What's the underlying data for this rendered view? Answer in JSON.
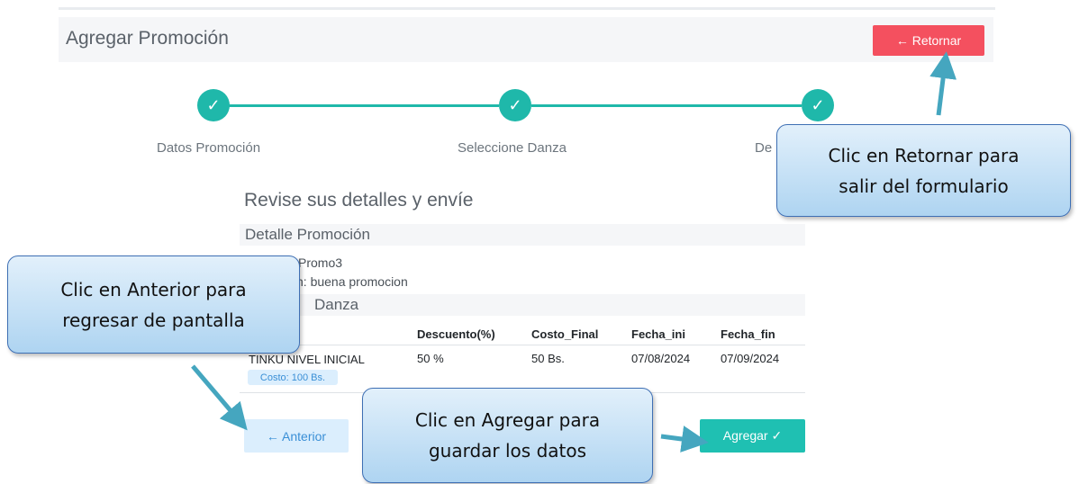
{
  "header": {
    "title": "Agregar Promoción",
    "retornar_label": "← Retornar"
  },
  "stepper": {
    "steps": [
      {
        "label": "Datos Promoción",
        "icon": "check-icon"
      },
      {
        "label": "Seleccione Danza",
        "icon": "check-icon"
      },
      {
        "label": "De",
        "icon": "check-icon"
      }
    ],
    "accent_color": "#1fb8aa"
  },
  "review": {
    "heading": "Revise sus detalles y envíe",
    "promo_section": "Detalle Promoción",
    "nombre_line": "Promo3",
    "descripcion_line": "n: buena promocion",
    "danza_section": "Danza"
  },
  "table": {
    "headers": [
      "Descuento(%)",
      "Costo_Final",
      "Fecha_ini",
      "Fecha_fin"
    ],
    "row": {
      "danza": "TINKU NIVEL INICIAL",
      "costo_badge": "Costo: 100 Bs.",
      "descuento": "50 %",
      "costo_final": "50 Bs.",
      "fecha_ini": "07/08/2024",
      "fecha_fin": "07/09/2024"
    }
  },
  "buttons": {
    "anterior": "← Anterior",
    "agregar": "Agregar ✓"
  },
  "callouts": {
    "retornar": [
      "Clic en Retornar para",
      "salir del formulario"
    ],
    "anterior": [
      "Clic en Anterior para",
      "regresar de pantalla"
    ],
    "agregar": [
      "Clic en Agregar para",
      "guardar los datos"
    ]
  },
  "colors": {
    "danger": "#f4505f",
    "primary_light": "#dbeefd",
    "teal": "#1fc0b2",
    "callout_border": "#3e6fb4"
  }
}
